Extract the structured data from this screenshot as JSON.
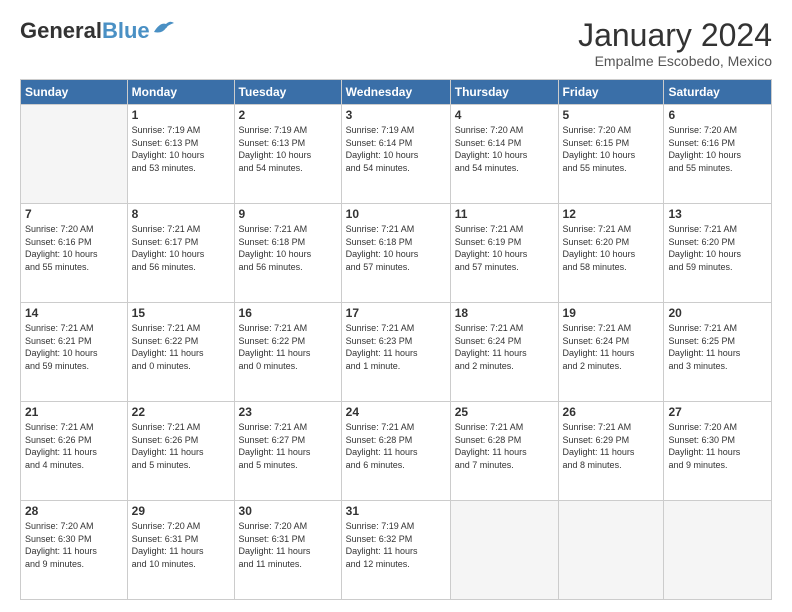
{
  "header": {
    "logo_general": "General",
    "logo_blue": "Blue",
    "month_year": "January 2024",
    "location": "Empalme Escobedo, Mexico"
  },
  "days_of_week": [
    "Sunday",
    "Monday",
    "Tuesday",
    "Wednesday",
    "Thursday",
    "Friday",
    "Saturday"
  ],
  "weeks": [
    [
      {
        "num": "",
        "info": ""
      },
      {
        "num": "1",
        "info": "Sunrise: 7:19 AM\nSunset: 6:13 PM\nDaylight: 10 hours\nand 53 minutes."
      },
      {
        "num": "2",
        "info": "Sunrise: 7:19 AM\nSunset: 6:13 PM\nDaylight: 10 hours\nand 54 minutes."
      },
      {
        "num": "3",
        "info": "Sunrise: 7:19 AM\nSunset: 6:14 PM\nDaylight: 10 hours\nand 54 minutes."
      },
      {
        "num": "4",
        "info": "Sunrise: 7:20 AM\nSunset: 6:14 PM\nDaylight: 10 hours\nand 54 minutes."
      },
      {
        "num": "5",
        "info": "Sunrise: 7:20 AM\nSunset: 6:15 PM\nDaylight: 10 hours\nand 55 minutes."
      },
      {
        "num": "6",
        "info": "Sunrise: 7:20 AM\nSunset: 6:16 PM\nDaylight: 10 hours\nand 55 minutes."
      }
    ],
    [
      {
        "num": "7",
        "info": "Sunrise: 7:20 AM\nSunset: 6:16 PM\nDaylight: 10 hours\nand 55 minutes."
      },
      {
        "num": "8",
        "info": "Sunrise: 7:21 AM\nSunset: 6:17 PM\nDaylight: 10 hours\nand 56 minutes."
      },
      {
        "num": "9",
        "info": "Sunrise: 7:21 AM\nSunset: 6:18 PM\nDaylight: 10 hours\nand 56 minutes."
      },
      {
        "num": "10",
        "info": "Sunrise: 7:21 AM\nSunset: 6:18 PM\nDaylight: 10 hours\nand 57 minutes."
      },
      {
        "num": "11",
        "info": "Sunrise: 7:21 AM\nSunset: 6:19 PM\nDaylight: 10 hours\nand 57 minutes."
      },
      {
        "num": "12",
        "info": "Sunrise: 7:21 AM\nSunset: 6:20 PM\nDaylight: 10 hours\nand 58 minutes."
      },
      {
        "num": "13",
        "info": "Sunrise: 7:21 AM\nSunset: 6:20 PM\nDaylight: 10 hours\nand 59 minutes."
      }
    ],
    [
      {
        "num": "14",
        "info": "Sunrise: 7:21 AM\nSunset: 6:21 PM\nDaylight: 10 hours\nand 59 minutes."
      },
      {
        "num": "15",
        "info": "Sunrise: 7:21 AM\nSunset: 6:22 PM\nDaylight: 11 hours\nand 0 minutes."
      },
      {
        "num": "16",
        "info": "Sunrise: 7:21 AM\nSunset: 6:22 PM\nDaylight: 11 hours\nand 0 minutes."
      },
      {
        "num": "17",
        "info": "Sunrise: 7:21 AM\nSunset: 6:23 PM\nDaylight: 11 hours\nand 1 minute."
      },
      {
        "num": "18",
        "info": "Sunrise: 7:21 AM\nSunset: 6:24 PM\nDaylight: 11 hours\nand 2 minutes."
      },
      {
        "num": "19",
        "info": "Sunrise: 7:21 AM\nSunset: 6:24 PM\nDaylight: 11 hours\nand 2 minutes."
      },
      {
        "num": "20",
        "info": "Sunrise: 7:21 AM\nSunset: 6:25 PM\nDaylight: 11 hours\nand 3 minutes."
      }
    ],
    [
      {
        "num": "21",
        "info": "Sunrise: 7:21 AM\nSunset: 6:26 PM\nDaylight: 11 hours\nand 4 minutes."
      },
      {
        "num": "22",
        "info": "Sunrise: 7:21 AM\nSunset: 6:26 PM\nDaylight: 11 hours\nand 5 minutes."
      },
      {
        "num": "23",
        "info": "Sunrise: 7:21 AM\nSunset: 6:27 PM\nDaylight: 11 hours\nand 5 minutes."
      },
      {
        "num": "24",
        "info": "Sunrise: 7:21 AM\nSunset: 6:28 PM\nDaylight: 11 hours\nand 6 minutes."
      },
      {
        "num": "25",
        "info": "Sunrise: 7:21 AM\nSunset: 6:28 PM\nDaylight: 11 hours\nand 7 minutes."
      },
      {
        "num": "26",
        "info": "Sunrise: 7:21 AM\nSunset: 6:29 PM\nDaylight: 11 hours\nand 8 minutes."
      },
      {
        "num": "27",
        "info": "Sunrise: 7:20 AM\nSunset: 6:30 PM\nDaylight: 11 hours\nand 9 minutes."
      }
    ],
    [
      {
        "num": "28",
        "info": "Sunrise: 7:20 AM\nSunset: 6:30 PM\nDaylight: 11 hours\nand 9 minutes."
      },
      {
        "num": "29",
        "info": "Sunrise: 7:20 AM\nSunset: 6:31 PM\nDaylight: 11 hours\nand 10 minutes."
      },
      {
        "num": "30",
        "info": "Sunrise: 7:20 AM\nSunset: 6:31 PM\nDaylight: 11 hours\nand 11 minutes."
      },
      {
        "num": "31",
        "info": "Sunrise: 7:19 AM\nSunset: 6:32 PM\nDaylight: 11 hours\nand 12 minutes."
      },
      {
        "num": "",
        "info": ""
      },
      {
        "num": "",
        "info": ""
      },
      {
        "num": "",
        "info": ""
      }
    ]
  ]
}
